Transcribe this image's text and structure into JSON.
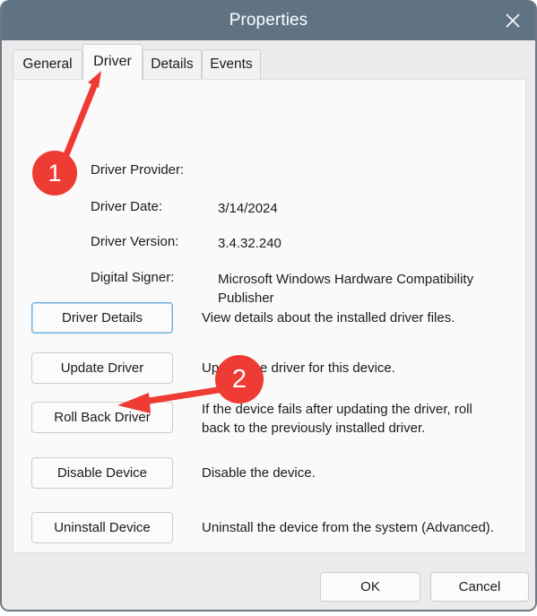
{
  "window": {
    "title": "Properties",
    "close_icon": "close-icon",
    "titlebar_color": "#5f7383"
  },
  "tabs": [
    {
      "label": "General",
      "active": false
    },
    {
      "label": "Driver",
      "active": true
    },
    {
      "label": "Details",
      "active": false
    },
    {
      "label": "Events",
      "active": false
    }
  ],
  "driver_info": [
    {
      "label": "Driver Provider:",
      "value": ""
    },
    {
      "label": "Driver Date:",
      "value": "3/14/2024"
    },
    {
      "label": "Driver Version:",
      "value": "3.4.32.240"
    },
    {
      "label": "Digital Signer:",
      "value": "Microsoft Windows Hardware Compatibility Publisher"
    }
  ],
  "actions": [
    {
      "button": "Driver Details",
      "description": "View details about the installed driver files.",
      "focused": true
    },
    {
      "button": "Update Driver",
      "description": "Update the driver for this device.",
      "focused": false
    },
    {
      "button": "Roll Back Driver",
      "description": "If the device fails after updating the driver, roll back to the previously installed driver.",
      "focused": false
    },
    {
      "button": "Disable Device",
      "description": "Disable the device.",
      "focused": false
    },
    {
      "button": "Uninstall Device",
      "description": "Uninstall the device from the system (Advanced).",
      "focused": false
    }
  ],
  "footer": {
    "ok_label": "OK",
    "cancel_label": "Cancel"
  },
  "annotations": {
    "color": "#ee3b33",
    "markers": [
      {
        "label": "1",
        "points_to": "Driver tab"
      },
      {
        "label": "2",
        "points_to": "Roll Back Driver button"
      }
    ]
  }
}
